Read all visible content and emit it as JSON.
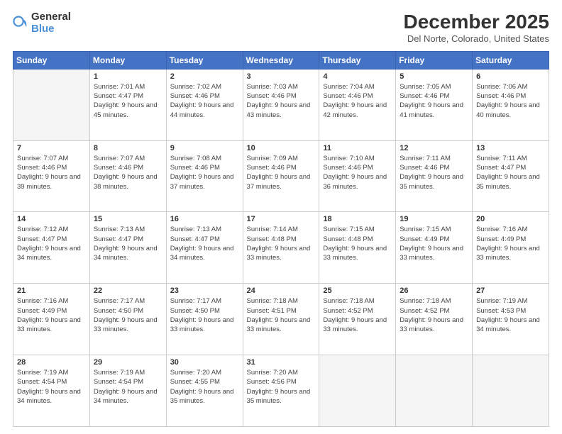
{
  "logo": {
    "text_general": "General",
    "text_blue": "Blue"
  },
  "header": {
    "month_year": "December 2025",
    "location": "Del Norte, Colorado, United States"
  },
  "weekdays": [
    "Sunday",
    "Monday",
    "Tuesday",
    "Wednesday",
    "Thursday",
    "Friday",
    "Saturday"
  ],
  "weeks": [
    [
      {
        "day": "",
        "empty": true
      },
      {
        "day": "1",
        "sunrise": "7:01 AM",
        "sunset": "4:47 PM",
        "daylight": "9 hours and 45 minutes."
      },
      {
        "day": "2",
        "sunrise": "7:02 AM",
        "sunset": "4:46 PM",
        "daylight": "9 hours and 44 minutes."
      },
      {
        "day": "3",
        "sunrise": "7:03 AM",
        "sunset": "4:46 PM",
        "daylight": "9 hours and 43 minutes."
      },
      {
        "day": "4",
        "sunrise": "7:04 AM",
        "sunset": "4:46 PM",
        "daylight": "9 hours and 42 minutes."
      },
      {
        "day": "5",
        "sunrise": "7:05 AM",
        "sunset": "4:46 PM",
        "daylight": "9 hours and 41 minutes."
      },
      {
        "day": "6",
        "sunrise": "7:06 AM",
        "sunset": "4:46 PM",
        "daylight": "9 hours and 40 minutes."
      }
    ],
    [
      {
        "day": "7",
        "sunrise": "7:07 AM",
        "sunset": "4:46 PM",
        "daylight": "9 hours and 39 minutes."
      },
      {
        "day": "8",
        "sunrise": "7:07 AM",
        "sunset": "4:46 PM",
        "daylight": "9 hours and 38 minutes."
      },
      {
        "day": "9",
        "sunrise": "7:08 AM",
        "sunset": "4:46 PM",
        "daylight": "9 hours and 37 minutes."
      },
      {
        "day": "10",
        "sunrise": "7:09 AM",
        "sunset": "4:46 PM",
        "daylight": "9 hours and 37 minutes."
      },
      {
        "day": "11",
        "sunrise": "7:10 AM",
        "sunset": "4:46 PM",
        "daylight": "9 hours and 36 minutes."
      },
      {
        "day": "12",
        "sunrise": "7:11 AM",
        "sunset": "4:46 PM",
        "daylight": "9 hours and 35 minutes."
      },
      {
        "day": "13",
        "sunrise": "7:11 AM",
        "sunset": "4:47 PM",
        "daylight": "9 hours and 35 minutes."
      }
    ],
    [
      {
        "day": "14",
        "sunrise": "7:12 AM",
        "sunset": "4:47 PM",
        "daylight": "9 hours and 34 minutes."
      },
      {
        "day": "15",
        "sunrise": "7:13 AM",
        "sunset": "4:47 PM",
        "daylight": "9 hours and 34 minutes."
      },
      {
        "day": "16",
        "sunrise": "7:13 AM",
        "sunset": "4:47 PM",
        "daylight": "9 hours and 34 minutes."
      },
      {
        "day": "17",
        "sunrise": "7:14 AM",
        "sunset": "4:48 PM",
        "daylight": "9 hours and 33 minutes."
      },
      {
        "day": "18",
        "sunrise": "7:15 AM",
        "sunset": "4:48 PM",
        "daylight": "9 hours and 33 minutes."
      },
      {
        "day": "19",
        "sunrise": "7:15 AM",
        "sunset": "4:49 PM",
        "daylight": "9 hours and 33 minutes."
      },
      {
        "day": "20",
        "sunrise": "7:16 AM",
        "sunset": "4:49 PM",
        "daylight": "9 hours and 33 minutes."
      }
    ],
    [
      {
        "day": "21",
        "sunrise": "7:16 AM",
        "sunset": "4:49 PM",
        "daylight": "9 hours and 33 minutes."
      },
      {
        "day": "22",
        "sunrise": "7:17 AM",
        "sunset": "4:50 PM",
        "daylight": "9 hours and 33 minutes."
      },
      {
        "day": "23",
        "sunrise": "7:17 AM",
        "sunset": "4:50 PM",
        "daylight": "9 hours and 33 minutes."
      },
      {
        "day": "24",
        "sunrise": "7:18 AM",
        "sunset": "4:51 PM",
        "daylight": "9 hours and 33 minutes."
      },
      {
        "day": "25",
        "sunrise": "7:18 AM",
        "sunset": "4:52 PM",
        "daylight": "9 hours and 33 minutes."
      },
      {
        "day": "26",
        "sunrise": "7:18 AM",
        "sunset": "4:52 PM",
        "daylight": "9 hours and 33 minutes."
      },
      {
        "day": "27",
        "sunrise": "7:19 AM",
        "sunset": "4:53 PM",
        "daylight": "9 hours and 34 minutes."
      }
    ],
    [
      {
        "day": "28",
        "sunrise": "7:19 AM",
        "sunset": "4:54 PM",
        "daylight": "9 hours and 34 minutes."
      },
      {
        "day": "29",
        "sunrise": "7:19 AM",
        "sunset": "4:54 PM",
        "daylight": "9 hours and 34 minutes."
      },
      {
        "day": "30",
        "sunrise": "7:20 AM",
        "sunset": "4:55 PM",
        "daylight": "9 hours and 35 minutes."
      },
      {
        "day": "31",
        "sunrise": "7:20 AM",
        "sunset": "4:56 PM",
        "daylight": "9 hours and 35 minutes."
      },
      {
        "day": "",
        "empty": true
      },
      {
        "day": "",
        "empty": true
      },
      {
        "day": "",
        "empty": true
      }
    ]
  ],
  "labels": {
    "sunrise": "Sunrise:",
    "sunset": "Sunset:",
    "daylight": "Daylight:"
  }
}
